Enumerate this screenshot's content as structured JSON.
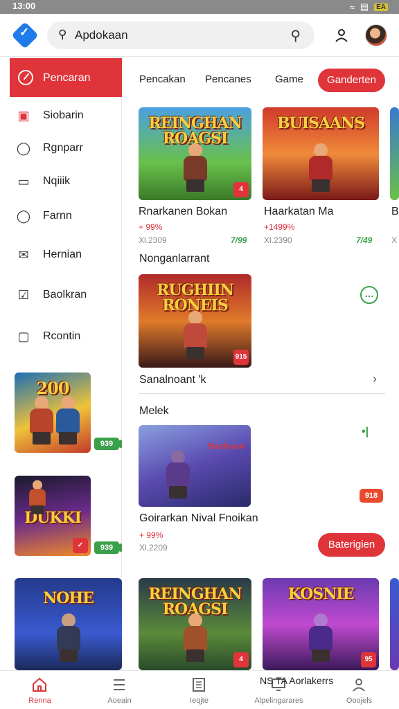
{
  "status": {
    "time": "13:00",
    "battery": "EA"
  },
  "search": {
    "value": "Apdokaan"
  },
  "sidebar": {
    "active": "Pencaran",
    "items": [
      {
        "label": "Siobarin",
        "icon": "image-icon"
      },
      {
        "label": "Rgnparr",
        "icon": "chat-icon"
      },
      {
        "label": "Nqiiik",
        "icon": "document-icon"
      },
      {
        "label": "Farnn",
        "icon": "person-icon"
      },
      {
        "label": "Hernian",
        "icon": "mail-icon"
      },
      {
        "label": "Baolkran",
        "icon": "check-icon"
      },
      {
        "label": "Rcontin",
        "icon": "square-icon"
      }
    ],
    "cards": [
      {
        "art": "200",
        "price": "939"
      },
      {
        "art": "DUKKI",
        "price": "939"
      },
      {
        "art": "NOHE",
        "price": ""
      }
    ]
  },
  "tabs": [
    {
      "label": "Pencakan"
    },
    {
      "label": "Pencanes"
    },
    {
      "label": "Game"
    },
    {
      "label": "Ganderten",
      "active": true
    }
  ],
  "featured": [
    {
      "art": "REINGHAN ROAGSI",
      "badge": "4",
      "title": "Rnarkanen Bokan",
      "rating": "+ 99%",
      "price": "Xl.2309",
      "green": "7/99"
    },
    {
      "art": "BUISAANS",
      "badge": "",
      "title": "Haarkatan Ma",
      "rating": "+1499%",
      "price": "Xl.2390",
      "green": "7/49"
    },
    {
      "art": "",
      "badge": "",
      "title": "B",
      "rating": "",
      "price": "X",
      "green": ""
    }
  ],
  "section1": {
    "title": "Nonganlarrant",
    "card_art": "RUGHIIN RONEIS",
    "card_badge": "915",
    "row_label": "Sanalnoant 'k"
  },
  "section2": {
    "title": "Melek",
    "card_art": "Harleaot",
    "title2": "Goirarkan Nival Fnoikan",
    "rating": "+ 99%",
    "price": "Xl.2209",
    "pill": "918",
    "button": "Baterigien"
  },
  "bottom_cards": [
    {
      "art": "REINGHAN ROAGSI",
      "badge": "4"
    },
    {
      "art": "KOSNIE",
      "badge": "95"
    }
  ],
  "nav": [
    {
      "label": "Renna",
      "icon": "home-icon",
      "active": true
    },
    {
      "label": "Aoeain",
      "icon": "list-icon"
    },
    {
      "label": "Ieqjte",
      "icon": "document-icon"
    },
    {
      "label": "Alpelingarares",
      "icon": "monitor-icon"
    },
    {
      "label": "Ooojels",
      "icon": "person-icon"
    }
  ],
  "nav_overlay": "NS TA Aorlakerrs",
  "colors": {
    "accent": "#e0343b",
    "green": "#3aa04a",
    "brand": "#1f7bea"
  }
}
